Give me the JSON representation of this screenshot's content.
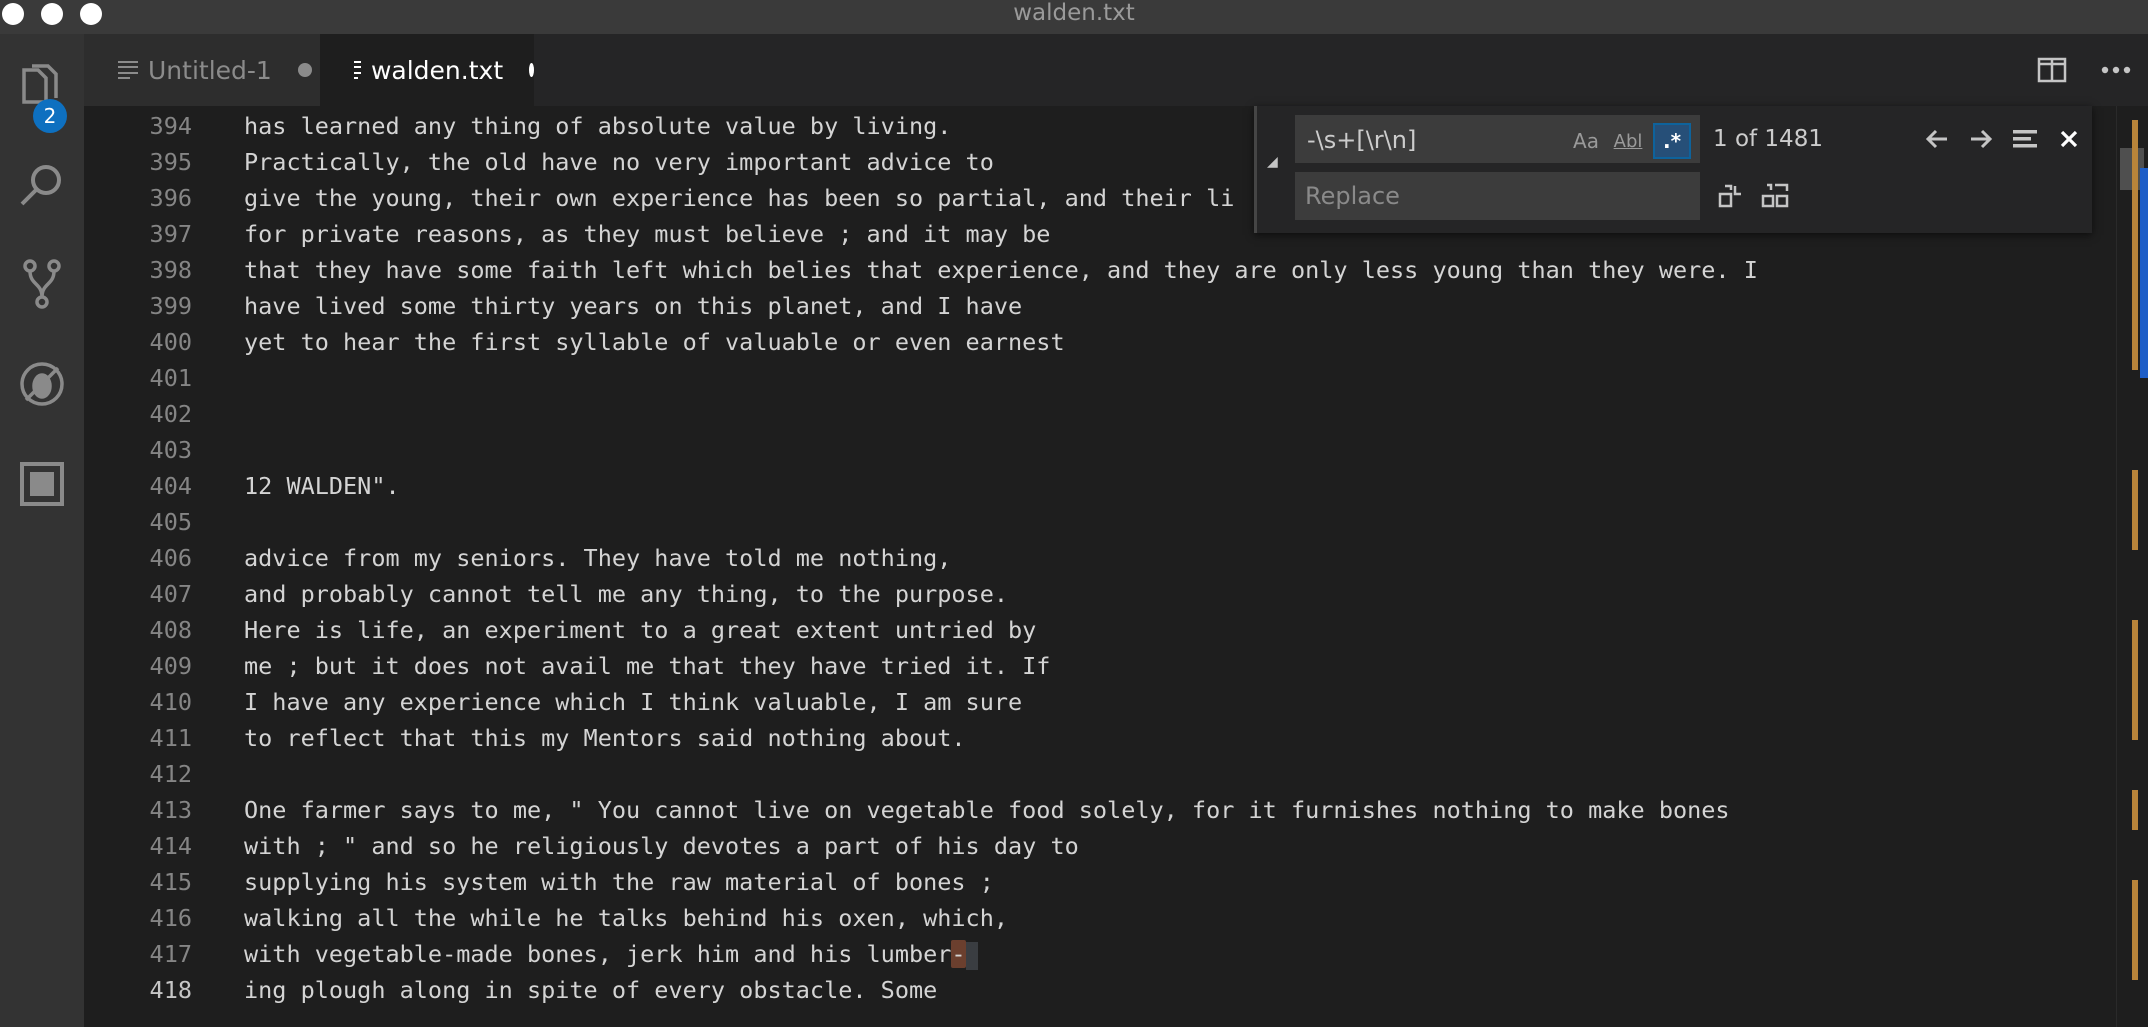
{
  "window": {
    "title": "walden.txt"
  },
  "activity_bar": {
    "items": [
      {
        "icon": "files-icon",
        "badge": "2"
      },
      {
        "icon": "search-icon"
      },
      {
        "icon": "source-control-icon"
      },
      {
        "icon": "debug-icon"
      },
      {
        "icon": "extensions-icon"
      }
    ]
  },
  "tabs": [
    {
      "label": "Untitled-1",
      "dirty": true,
      "active": false
    },
    {
      "label": "walden.txt",
      "dirty": true,
      "active": true
    }
  ],
  "find_widget": {
    "find_value": "-\\s+[\\r\\n]",
    "match_case_label": "Aa",
    "whole_word_label": "Abl",
    "regex_label": ".*",
    "regex_enabled": true,
    "match_count": "1 of 1481",
    "replace_placeholder": "Replace"
  },
  "editor": {
    "active_line": "418",
    "lines": [
      {
        "n": "394",
        "text": "has learned any thing of absolute value by living."
      },
      {
        "n": "395",
        "text": "Practically, the old have no very important advice to"
      },
      {
        "n": "396",
        "text": "give the young, their own experience has been so partial, and their li"
      },
      {
        "n": "397",
        "text": "for private reasons, as they must believe ; and it may be"
      },
      {
        "n": "398",
        "text": "that they have some faith left which belies that experience, and they are only less young than they were. I"
      },
      {
        "n": "399",
        "text": "have lived some thirty years on this planet, and I have"
      },
      {
        "n": "400",
        "text": "yet to hear the first syllable of valuable or even earnest"
      },
      {
        "n": "401",
        "text": ""
      },
      {
        "n": "402",
        "text": ""
      },
      {
        "n": "403",
        "text": ""
      },
      {
        "n": "404",
        "text": "12 WALDEN\"."
      },
      {
        "n": "405",
        "text": ""
      },
      {
        "n": "406",
        "text": "advice from my seniors. They have told me nothing,"
      },
      {
        "n": "407",
        "text": "and probably cannot tell me any thing, to the purpose."
      },
      {
        "n": "408",
        "text": "Here is life, an experiment to a great extent untried by"
      },
      {
        "n": "409",
        "text": "me ; but it does not avail me that they have tried it. If"
      },
      {
        "n": "410",
        "text": "I have any experience which I think valuable, I am sure"
      },
      {
        "n": "411",
        "text": "to reflect that this my Mentors said nothing about."
      },
      {
        "n": "412",
        "text": ""
      },
      {
        "n": "413",
        "text": "One farmer says to me, \" You cannot live on vegetable food solely, for it furnishes nothing to make bones"
      },
      {
        "n": "414",
        "text": "with ; \" and so he religiously devotes a part of his day to"
      },
      {
        "n": "415",
        "text": "supplying his system with the raw material of bones ;"
      },
      {
        "n": "416",
        "text": "walking all the while he talks behind his oxen, which,"
      },
      {
        "n": "417",
        "text": "with vegetable-made bones, jerk him and his lumber",
        "match": "-"
      },
      {
        "n": "418",
        "text": "ing plough along in spite of every obstacle. Some"
      }
    ]
  },
  "colors": {
    "accent": "#0e70c0",
    "match_highlight": "#6b3f2e",
    "overview_ruler": "#b8843a"
  }
}
